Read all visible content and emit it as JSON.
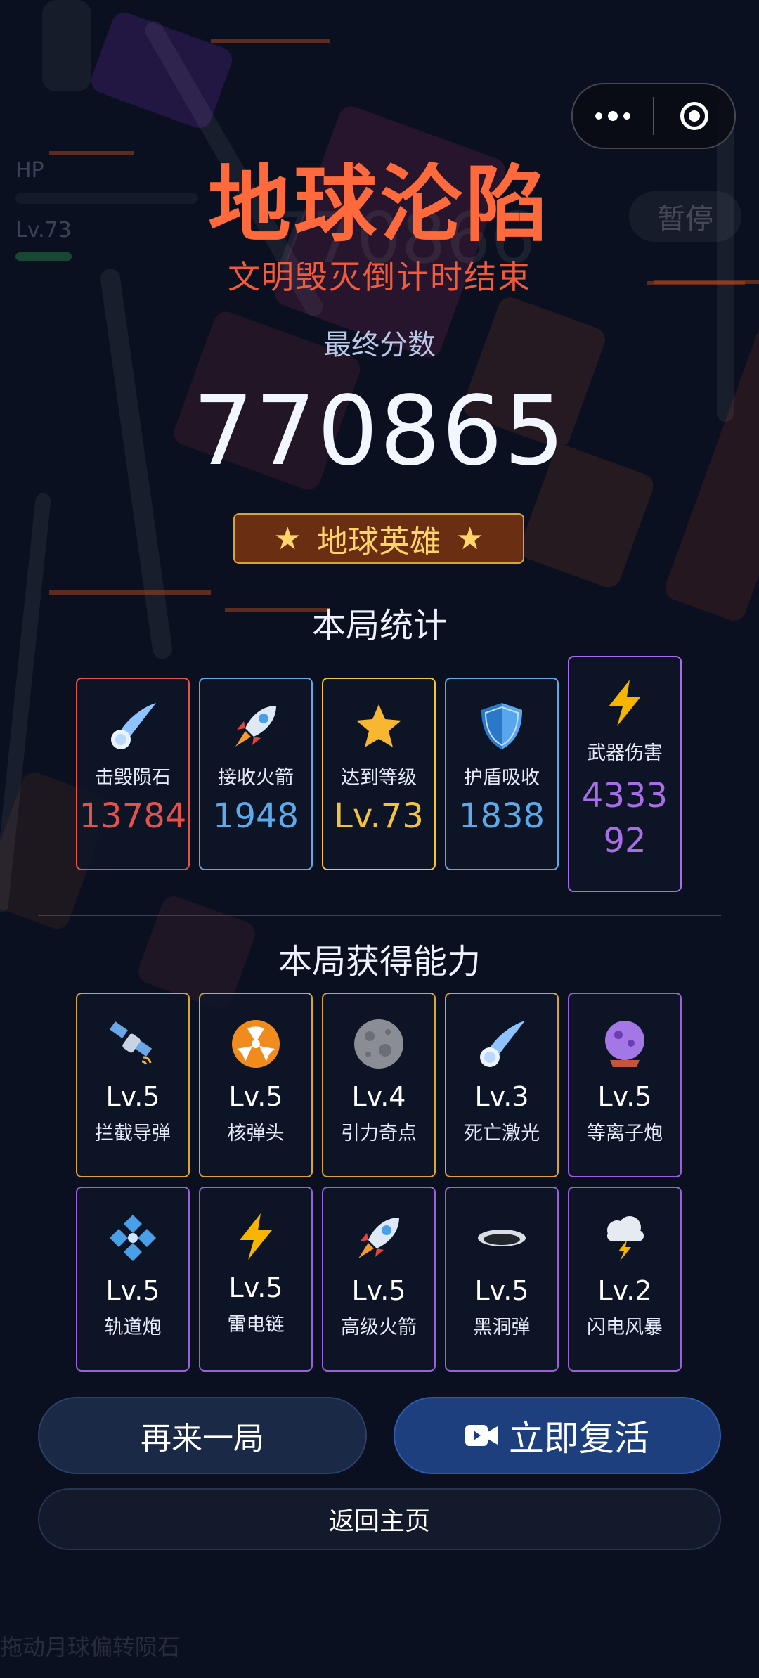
{
  "background_hud": {
    "hp_label": "HP",
    "level_label": "Lv.73",
    "faded_score": "770866",
    "pause_label": "暂停",
    "bottom_hint": "拖动月球偏转陨石"
  },
  "capsule": {
    "menu_icon": "more-dots-icon",
    "close_icon": "target-circle-icon"
  },
  "header": {
    "title": "地球沦陷",
    "subtitle": "文明毁灭倒计时结束",
    "score_label": "最终分数",
    "score": "770865"
  },
  "badge": {
    "text": "地球英雄",
    "star_left": "★",
    "star_right": "★",
    "color": "#d8a43a"
  },
  "stats": {
    "title": "本局统计",
    "items": [
      {
        "icon": "comet-icon",
        "label": "击毁陨石",
        "value": "13784",
        "color": "#e4524b"
      },
      {
        "icon": "rocket-icon",
        "label": "接收火箭",
        "value": "1948",
        "color": "#5ea9ea"
      },
      {
        "icon": "star-icon",
        "label": "达到等级",
        "value": "Lv.73",
        "color": "#f3c340"
      },
      {
        "icon": "shield-icon",
        "label": "护盾吸收",
        "value": "1838",
        "color": "#5ea9ea"
      },
      {
        "icon": "lightning-icon",
        "label": "武器伤害",
        "value_line1": "4333",
        "value_line2": "92",
        "color": "#a86ee6"
      }
    ]
  },
  "abilities": {
    "title": "本局获得能力",
    "row1": [
      {
        "icon": "satellite-icon",
        "level": "Lv.5",
        "name": "拦截导弹",
        "border": "#d6a63a"
      },
      {
        "icon": "radioactive-icon",
        "level": "Lv.5",
        "name": "核弹头",
        "border": "#d6a63a"
      },
      {
        "icon": "moon-icon",
        "level": "Lv.4",
        "name": "引力奇点",
        "border": "#d6a63a"
      },
      {
        "icon": "comet-icon",
        "level": "Lv.3",
        "name": "死亡激光",
        "border": "#d6a63a"
      },
      {
        "icon": "crystal-ball-icon",
        "level": "Lv.5",
        "name": "等离子炮",
        "border": "#9b62d8"
      }
    ],
    "row2": [
      {
        "icon": "diamond-cluster-icon",
        "level": "Lv.5",
        "name": "轨道炮",
        "border": "#9b62d8"
      },
      {
        "icon": "lightning-icon",
        "level": "Lv.5",
        "name": "雷电链",
        "border": "#9b62d8"
      },
      {
        "icon": "rocket-icon",
        "level": "Lv.5",
        "name": "高级火箭",
        "border": "#9b62d8"
      },
      {
        "icon": "black-hole-icon",
        "level": "Lv.5",
        "name": "黑洞弹",
        "border": "#9b62d8"
      },
      {
        "icon": "storm-cloud-icon",
        "level": "Lv.2",
        "name": "闪电风暴",
        "border": "#9b62d8"
      }
    ]
  },
  "buttons": {
    "again": "再来一局",
    "revive": "立即复活",
    "revive_icon": "video-camera-icon",
    "home": "返回主页"
  }
}
